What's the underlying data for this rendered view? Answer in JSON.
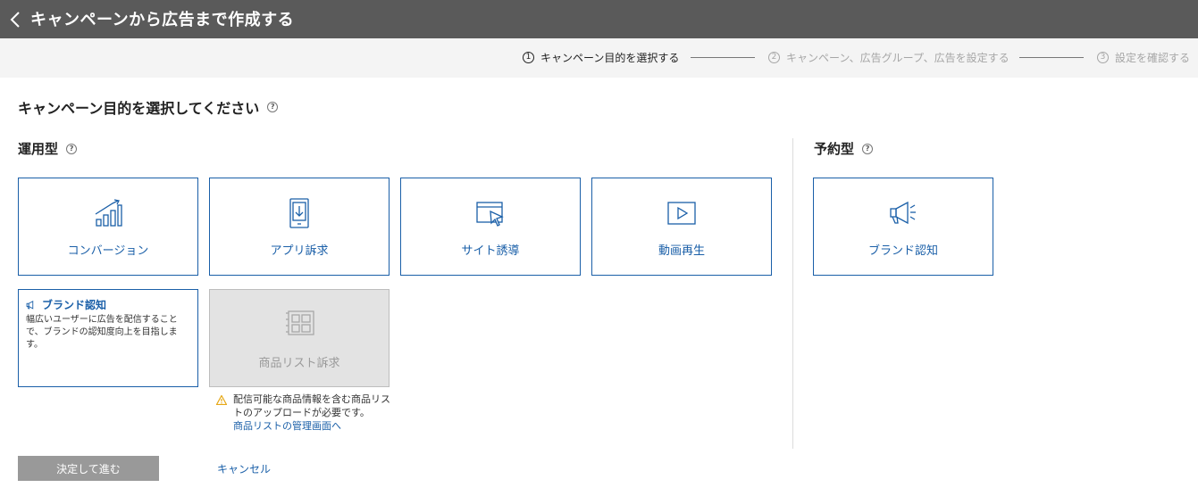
{
  "header": {
    "title": "キャンペーンから広告まで作成する"
  },
  "steps": [
    {
      "num": "1",
      "label": "キャンペーン目的を選択する"
    },
    {
      "num": "2",
      "label": "キャンペーン、広告グループ、広告を設定する"
    },
    {
      "num": "3",
      "label": "設定を確認する"
    }
  ],
  "page": {
    "heading": "キャンペーン目的を選択してください",
    "help": "?"
  },
  "sections": {
    "performance": {
      "title": "運用型",
      "help": "?"
    },
    "reservation": {
      "title": "予約型",
      "help": "?"
    }
  },
  "cards": {
    "conversion": {
      "label": "コンバージョン",
      "icon": "bar-chart-growth-icon"
    },
    "app": {
      "label": "アプリ訴求",
      "icon": "phone-download-icon"
    },
    "site": {
      "label": "サイト誘導",
      "icon": "browser-cursor-icon"
    },
    "video": {
      "label": "動画再生",
      "icon": "video-play-icon"
    },
    "brand_selected": {
      "title": "ブランド認知",
      "description": "幅広いユーザーに広告を配信することで、ブランドの認知度向上を目指します。",
      "icon": "megaphone-icon"
    },
    "product_list": {
      "label": "商品リスト訴求",
      "icon": "product-list-icon"
    },
    "reservation_brand": {
      "label": "ブランド認知",
      "icon": "megaphone-icon"
    }
  },
  "warning": {
    "text": "配信可能な商品情報を含む商品リストのアップロードが必要です。",
    "link": "商品リストの管理画面へ",
    "icon": "warning-triangle-icon"
  },
  "footer": {
    "submit_label": "決定して進む",
    "cancel_label": "キャンセル"
  },
  "colors": {
    "topbar": "#5a5a5a",
    "accent": "#1a5fa8",
    "disabled": "#e3e3e3",
    "warning": "#e6a817"
  }
}
